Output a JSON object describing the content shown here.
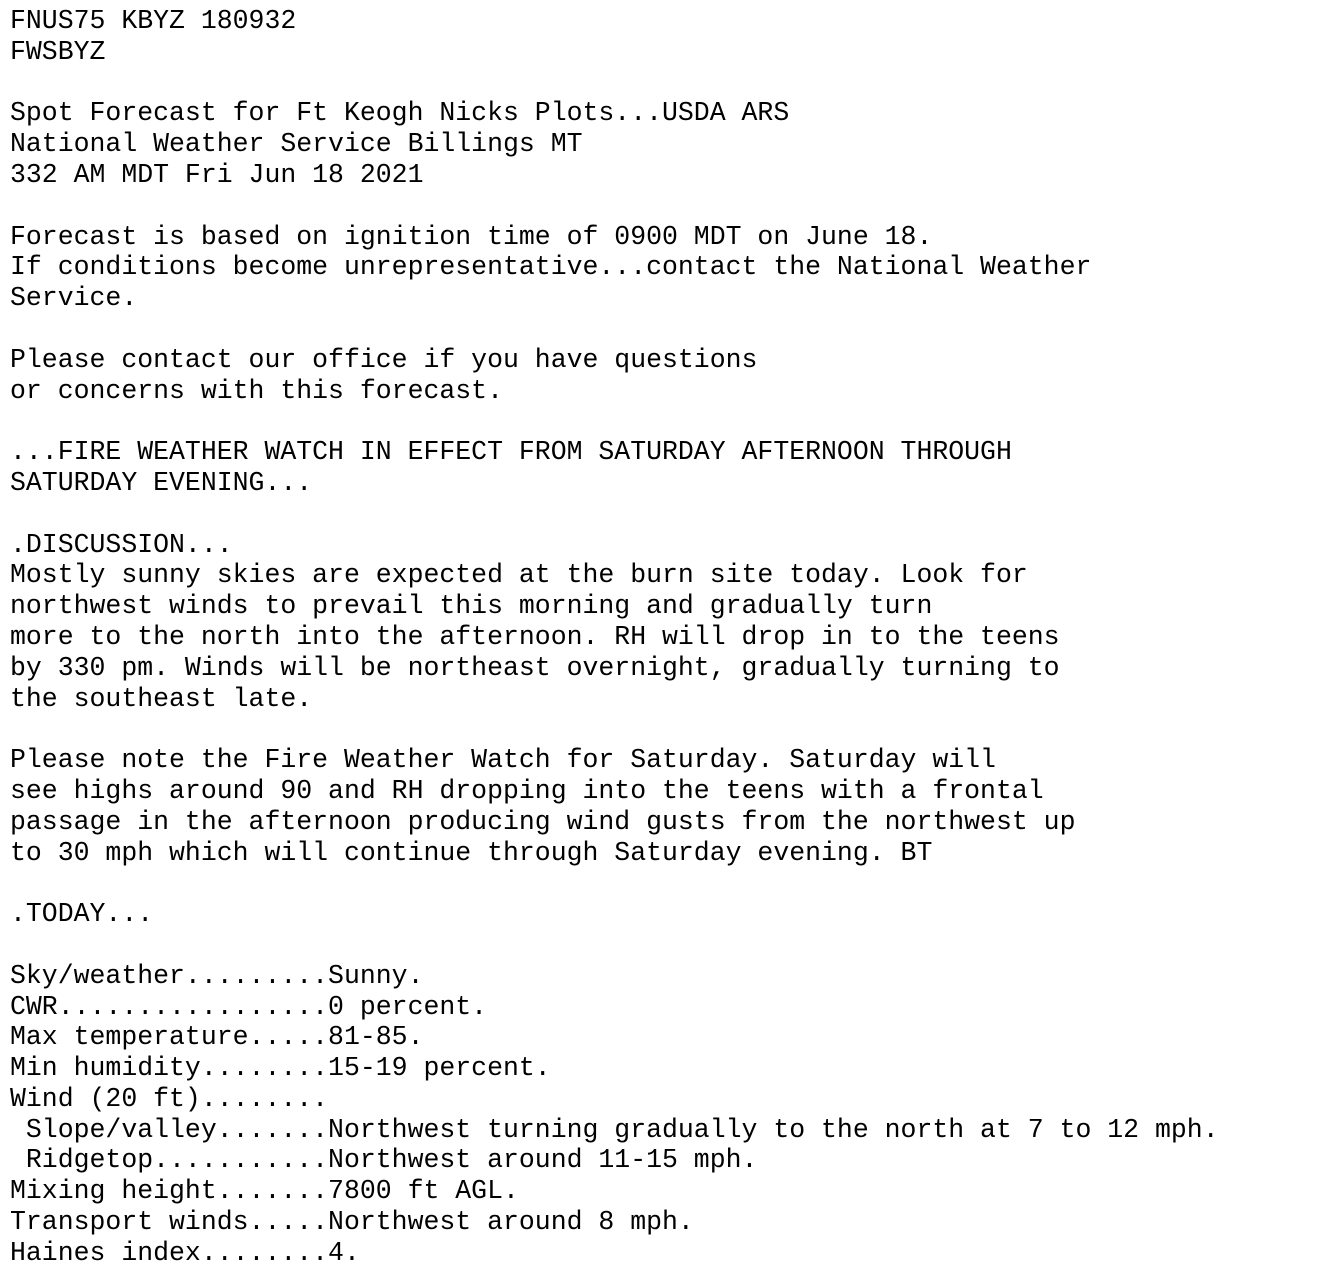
{
  "header": {
    "product_id": "FNUS75 KBYZ 180932",
    "awips_id": "FWSBYZ"
  },
  "title_block": {
    "title": "Spot Forecast for Ft Keogh Nicks Plots...USDA ARS",
    "office": "National Weather Service Billings MT",
    "issued": "332 AM MDT Fri Jun 18 2021"
  },
  "intro": {
    "line1": "Forecast is based on ignition time of 0900 MDT on June 18.",
    "line2": "If conditions become unrepresentative...contact the National Weather",
    "line3": "Service."
  },
  "contact": {
    "line1": "Please contact our office if you have questions",
    "line2": "or concerns with this forecast."
  },
  "headline": {
    "line1": "...FIRE WEATHER WATCH IN EFFECT FROM SATURDAY AFTERNOON THROUGH",
    "line2": "SATURDAY EVENING..."
  },
  "discussion": {
    "heading": ".DISCUSSION...",
    "para1": [
      "Mostly sunny skies are expected at the burn site today. Look for",
      "northwest winds to prevail this morning and gradually turn",
      "more to the north into the afternoon. RH will drop in to the teens",
      "by 330 pm. Winds will be northeast overnight, gradually turning to",
      "the southeast late."
    ],
    "para2": [
      "Please note the Fire Weather Watch for Saturday. Saturday will",
      "see highs around 90 and RH dropping into the teens with a frontal",
      "passage in the afternoon producing wind gusts from the northwest up",
      "to 30 mph which will continue through Saturday evening. BT"
    ]
  },
  "today": {
    "heading": ".TODAY...",
    "rows": [
      "Sky/weather.........Sunny.",
      "CWR.................0 percent.",
      "Max temperature.....81-85.",
      "Min humidity........15-19 percent.",
      "Wind (20 ft)........",
      " Slope/valley.......Northwest turning gradually to the north at 7 to 12 mph.",
      " Ridgetop...........Northwest around 11-15 mph.",
      "Mixing height.......7800 ft AGL.",
      "Transport winds.....Northwest around 8 mph.",
      "Haines index........4."
    ]
  }
}
